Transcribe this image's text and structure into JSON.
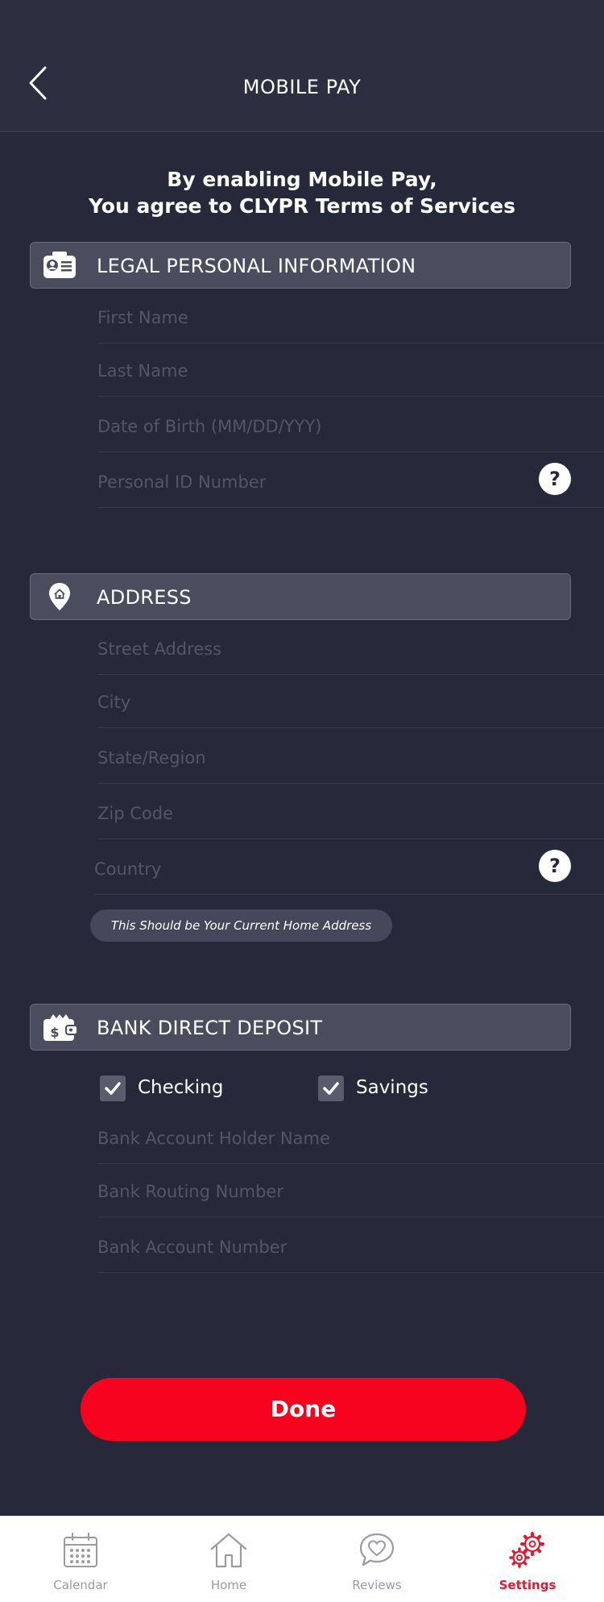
{
  "header": {
    "title": "MOBILE PAY"
  },
  "consent": {
    "line1": "By enabling Mobile Pay,",
    "line2": "You agree to CLYPR Terms of Services"
  },
  "personal": {
    "title": "LEGAL PERSONAL INFORMATION",
    "first_name_placeholder": "First Name",
    "last_name_placeholder": "Last Name",
    "dob_placeholder": "Date of Birth (MM/DD/YYY)",
    "personal_id_placeholder": "Personal ID Number"
  },
  "address": {
    "title": "ADDRESS",
    "street_placeholder": "Street Address",
    "city_placeholder": "City",
    "state_placeholder": "State/Region",
    "zip_placeholder": "Zip Code",
    "country_placeholder": "Country",
    "note": "This Should be Your Current Home Address"
  },
  "bank": {
    "title": "BANK DIRECT DEPOSIT",
    "checking_label": "Checking",
    "checking_checked": true,
    "savings_label": "Savings",
    "savings_checked": true,
    "holder_placeholder": "Bank Account Holder Name",
    "routing_placeholder": "Bank Routing Number",
    "account_placeholder": "Bank Account Number"
  },
  "done_label": "Done",
  "tabs": [
    {
      "label": "Calendar",
      "icon": "calendar-icon"
    },
    {
      "label": "Home",
      "icon": "home-icon"
    },
    {
      "label": "Reviews",
      "icon": "reviews-icon"
    },
    {
      "label": "Settings",
      "icon": "settings-icon",
      "active": true
    }
  ],
  "colors": {
    "background": "#272839",
    "accent": "#f7021f",
    "active_tab": "#e11a2e"
  }
}
